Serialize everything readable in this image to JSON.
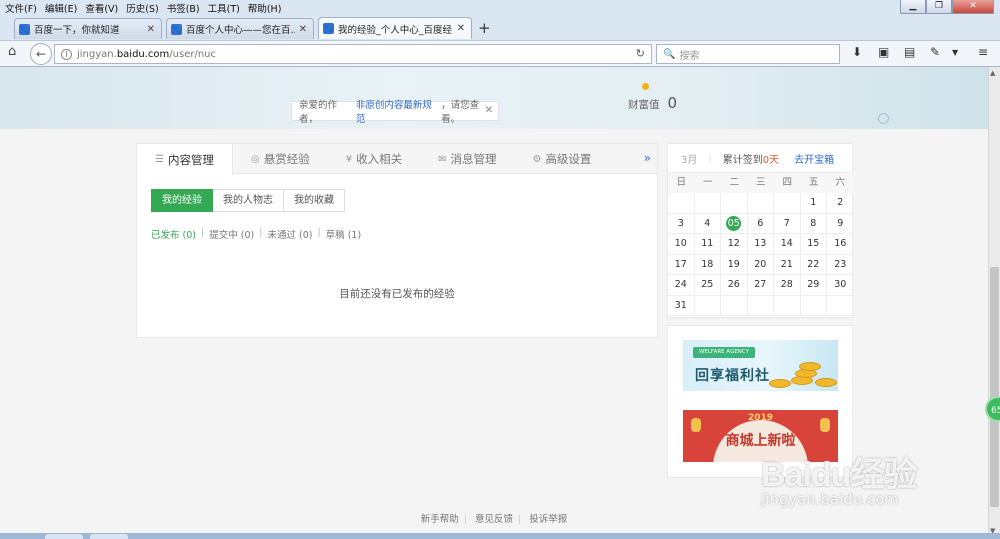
{
  "menubar": {
    "items": [
      "文件(F)",
      "编辑(E)",
      "查看(V)",
      "历史(S)",
      "书签(B)",
      "工具(T)",
      "帮助(H)"
    ]
  },
  "tabs": [
    {
      "title": "百度一下，你就知道"
    },
    {
      "title": "百度个人中心——您在百..."
    },
    {
      "title": "我的经验_个人中心_百度经..."
    }
  ],
  "addressbar": {
    "url_prefix": "jingyan.",
    "url_domain": "baidu.com",
    "url_path": "/user/nuc",
    "search_placeholder": "搜索"
  },
  "hero": {
    "notice_prefix": "亲爱的作者，",
    "notice_link": "非原创内容最新规范",
    "notice_suffix": "，请您查看。",
    "wealth_label": "财富值",
    "wealth_value": "0"
  },
  "main_tabs": [
    {
      "label": "内容管理",
      "icon": "list-icon",
      "glyph": "☰"
    },
    {
      "label": "悬赏经验",
      "icon": "reward-icon",
      "glyph": "◎"
    },
    {
      "label": "收入相关",
      "icon": "yen-icon",
      "glyph": "¥"
    },
    {
      "label": "消息管理",
      "icon": "mail-icon",
      "glyph": "✉"
    },
    {
      "label": "高级设置",
      "icon": "gear-icon",
      "glyph": "⚙"
    }
  ],
  "main_tabs_more": "»",
  "sub_tabs": [
    "我的经验",
    "我的人物志",
    "我的收藏"
  ],
  "filters": [
    {
      "label": "已发布",
      "count": "(0)"
    },
    {
      "label": "提交中",
      "count": "(0)"
    },
    {
      "label": "未通过",
      "count": "(0)"
    },
    {
      "label": "草稿",
      "count": "(1)"
    }
  ],
  "empty_message": "目前还没有已发布的经验",
  "calendar": {
    "month": "3月",
    "sign_label": "累计签到",
    "sign_days": "0天",
    "open_treasure": "去开宝箱",
    "weekdays": [
      "日",
      "一",
      "二",
      "三",
      "四",
      "五",
      "六"
    ],
    "days": [
      "",
      "",
      "",
      "",
      "",
      "1",
      "2",
      "3",
      "4",
      "05",
      "6",
      "7",
      "8",
      "9",
      "10",
      "11",
      "12",
      "13",
      "14",
      "15",
      "16",
      "17",
      "18",
      "19",
      "20",
      "21",
      "22",
      "23",
      "24",
      "25",
      "26",
      "27",
      "28",
      "29",
      "30",
      "31",
      "",
      "",
      "",
      "",
      "",
      ""
    ],
    "today": "05"
  },
  "ads": {
    "ad1_tag": "WELFARE AGENCY",
    "ad1_title": "回享福利社",
    "ad2_year": "2019",
    "ad2_title": "商城上新啦"
  },
  "watermark": {
    "logo": "Baidu经验",
    "url": "jingyan.baidu.com"
  },
  "footer": [
    "新手帮助",
    "意见反馈",
    "投诉举报"
  ],
  "float_badge": "65"
}
